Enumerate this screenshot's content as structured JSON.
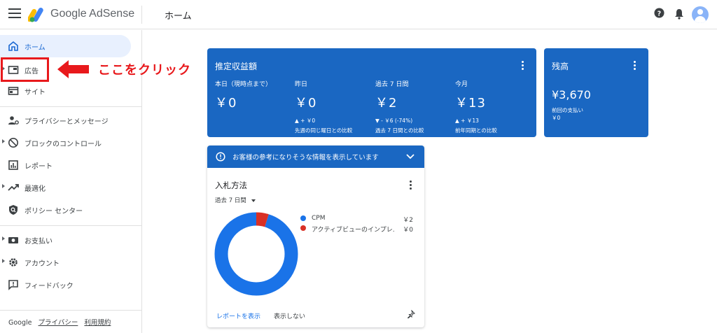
{
  "topbar": {
    "brand": "Google AdSense",
    "page_title": "ホーム"
  },
  "sidebar": {
    "items": [
      {
        "label": "ホーム",
        "icon": "home-icon"
      },
      {
        "label": "広告",
        "icon": "ads-icon"
      },
      {
        "label": "サイト",
        "icon": "sites-icon"
      },
      {
        "label": "プライバシーとメッセージ",
        "icon": "privacy-icon"
      },
      {
        "label": "ブロックのコントロール",
        "icon": "block-icon"
      },
      {
        "label": "レポート",
        "icon": "report-icon"
      },
      {
        "label": "最適化",
        "icon": "optimize-icon"
      },
      {
        "label": "ポリシー センター",
        "icon": "policy-icon"
      },
      {
        "label": "お支払い",
        "icon": "payments-icon"
      },
      {
        "label": "アカウント",
        "icon": "account-icon"
      },
      {
        "label": "フィードバック",
        "icon": "feedback-icon"
      }
    ],
    "footer": {
      "google": "Google",
      "privacy": "プライバシー",
      "terms": "利用規約"
    }
  },
  "annotation": {
    "text": "ここをクリック",
    "color": "#e8191c"
  },
  "earnings": {
    "title": "推定収益額",
    "stats": [
      {
        "label": "本日（現時点まで）",
        "value": "￥0",
        "change": "",
        "compare": ""
      },
      {
        "label": "昨日",
        "value": "￥0",
        "change": "▲ + ￥0",
        "compare": "先週の同じ曜日との比較"
      },
      {
        "label": "過去 7 日間",
        "value": "￥2",
        "change": "▼ - ￥6 (-74%)",
        "compare": "過去 7 日間との比較"
      },
      {
        "label": "今月",
        "value": "￥13",
        "change": "▲ + ￥13",
        "compare": "前年同期との比較"
      }
    ]
  },
  "balance": {
    "title": "残高",
    "value": "¥3,670",
    "last_payment_label": "前回の支払い",
    "last_payment_value": "￥0"
  },
  "insights": {
    "banner": "お客様の参考になりそうな情報を表示しています",
    "card_title": "入札方法",
    "range": "過去 7 日間",
    "legend": [
      {
        "name": "CPM",
        "value": "￥2",
        "color": "#1a73e8"
      },
      {
        "name": "アクティブビューのインプレ...",
        "value": "￥0",
        "color": "#d93025"
      }
    ],
    "view_report": "レポートを表示",
    "hide": "表示しない"
  },
  "chart_data": {
    "type": "pie",
    "categories": [
      "CPM",
      "アクティブビューのインプレ..."
    ],
    "values": [
      0.95,
      0.05
    ],
    "donut": true
  },
  "colors": {
    "primary": "#1a67c2",
    "active_bg": "#e8f0fe"
  }
}
